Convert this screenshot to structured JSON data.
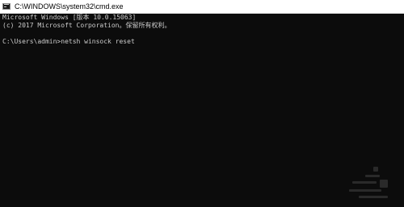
{
  "window": {
    "title": "C:\\WINDOWS\\system32\\cmd.exe",
    "icon": "cmd-icon"
  },
  "console": {
    "lines": [
      "Microsoft Windows [版本 10.0.15063]",
      "(c) 2017 Microsoft Corporation。保留所有权利。",
      "C:\\Users\\admin>netsh winsock reset"
    ]
  },
  "colors": {
    "console_background": "#0c0c0c",
    "console_text": "#cccccc",
    "titlebar_background": "#ffffff"
  }
}
